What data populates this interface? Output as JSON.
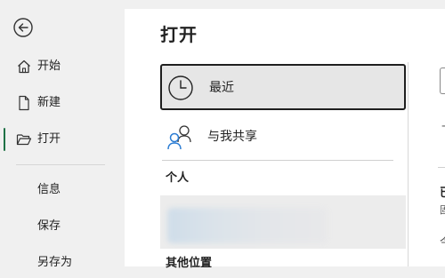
{
  "nav": {
    "items": [
      {
        "label": "开始",
        "icon": "home-icon"
      },
      {
        "label": "新建",
        "icon": "new-file-icon"
      },
      {
        "label": "打开",
        "icon": "open-folder-icon",
        "active": true
      },
      {
        "label": "信息"
      },
      {
        "label": "保存"
      },
      {
        "label": "另存为"
      }
    ]
  },
  "main": {
    "title": "打开",
    "recent_label": "最近",
    "shared_label": "与我共享",
    "personal_section": "个人",
    "other_section": "其他位置"
  },
  "right_pane": {
    "t1": "十",
    "t2": "已",
    "t3": "固",
    "t4": "今"
  },
  "colors": {
    "accent": "#1e7145",
    "nav_bg": "#f0f0f0",
    "selected_bg": "#e6e6e6",
    "shared_icon_blue": "#2b7cd3"
  }
}
